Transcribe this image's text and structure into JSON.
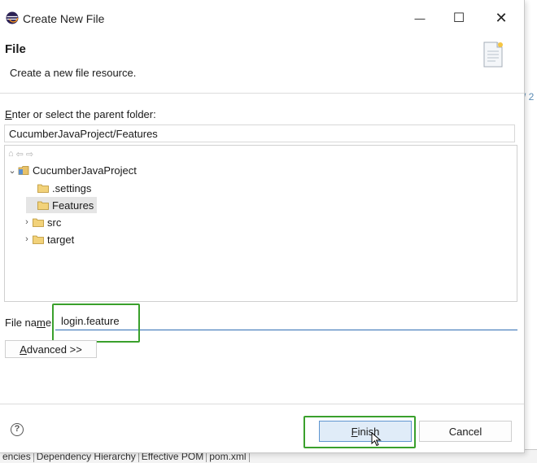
{
  "window": {
    "title": "Create New File",
    "minimize_glyph": "—",
    "maximize_glyph": "☐",
    "close_glyph": "✕"
  },
  "header": {
    "title": "File",
    "description": "Create a new file resource."
  },
  "parent_folder": {
    "label_first": "E",
    "label_rest": "nter or select the parent folder:",
    "value": "CucumberJavaProject/Features"
  },
  "tree": {
    "toolbar_icons": [
      "home-icon",
      "back-icon",
      "forward-icon"
    ],
    "project": {
      "label": "CucumberJavaProject",
      "expanded": true
    },
    "items": [
      {
        "label": ".settings",
        "expandable": false,
        "selected": false
      },
      {
        "label": "Features",
        "expandable": false,
        "selected": true
      },
      {
        "label": "src",
        "expandable": true,
        "selected": false
      },
      {
        "label": "target",
        "expandable": true,
        "selected": false
      }
    ]
  },
  "file_name": {
    "label_pre": "File na",
    "label_accel": "m",
    "label_post": "e:",
    "value": "login.feature"
  },
  "advanced_button": {
    "accel": "A",
    "rest": "dvanced >>"
  },
  "buttons": {
    "help": "?",
    "finish_accel": "F",
    "finish_rest": "inish",
    "cancel": "Cancel"
  },
  "background_ide": {
    "tabs": [
      "encies",
      "Dependency Hierarchy",
      "Effective POM",
      "pom.xml"
    ],
    "side_text": "/ 2"
  },
  "colors": {
    "highlight_box": "#3aa02c",
    "focus_underline": "#2f6db3",
    "finish_button_bg": "#e0ecf8"
  }
}
